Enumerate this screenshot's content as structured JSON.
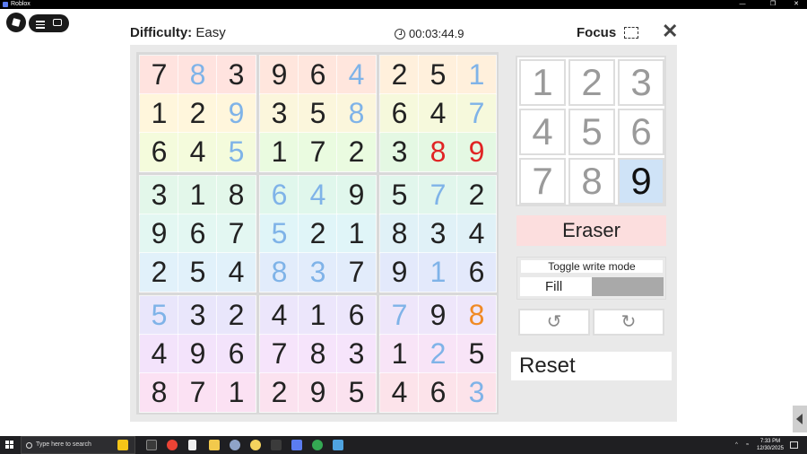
{
  "window": {
    "title": "Roblox",
    "controls": [
      "—",
      "❐",
      "✕"
    ]
  },
  "header": {
    "difficulty_label": "Difficulty:",
    "difficulty_value": "Easy",
    "timer": "00:03:44.9",
    "focus_label": "Focus",
    "close_symbol": "✕"
  },
  "board": {
    "boxes": [
      {
        "color": "#fff1d9",
        "rows": [
          [
            "7",
            "8",
            "3"
          ],
          [
            "1",
            "2",
            "9"
          ],
          [
            "6",
            "4",
            "5"
          ]
        ],
        "kinds": [
          [
            "g",
            "u",
            "g"
          ],
          [
            "g",
            "g",
            "u"
          ],
          [
            "g",
            "g",
            "u"
          ]
        ],
        "tints": [
          "#ffe3df",
          "#fff6dc",
          "#f4fbdc"
        ]
      },
      {
        "color": "#fff1d9",
        "rows": [
          [
            "9",
            "6",
            "4"
          ],
          [
            "3",
            "5",
            "8"
          ],
          [
            "1",
            "7",
            "2"
          ]
        ],
        "kinds": [
          [
            "g",
            "g",
            "u"
          ],
          [
            "g",
            "g",
            "u"
          ],
          [
            "g",
            "g",
            "g"
          ]
        ],
        "tints": [
          "#ffe6dd",
          "#fbf6dc",
          "#eafbe0"
        ]
      },
      {
        "color": "#fff1d9",
        "rows": [
          [
            "2",
            "5",
            "1"
          ],
          [
            "6",
            "4",
            "7"
          ],
          [
            "3",
            "8",
            "9"
          ]
        ],
        "kinds": [
          [
            "g",
            "g",
            "u"
          ],
          [
            "g",
            "g",
            "u"
          ],
          [
            "g",
            "e",
            "e"
          ]
        ],
        "tints": [
          "#fff0dc",
          "#f6f9dc",
          "#e4f8e3"
        ]
      },
      {
        "color": "#e5f6ee",
        "rows": [
          [
            "3",
            "1",
            "8"
          ],
          [
            "9",
            "6",
            "7"
          ],
          [
            "2",
            "5",
            "4"
          ]
        ],
        "kinds": [
          [
            "g",
            "g",
            "g"
          ],
          [
            "g",
            "g",
            "g"
          ],
          [
            "g",
            "g",
            "g"
          ]
        ],
        "tints": [
          "#e3f7ea",
          "#e3f7f2",
          "#e1f1fa"
        ]
      },
      {
        "color": "#e5f6ee",
        "rows": [
          [
            "6",
            "4",
            "9"
          ],
          [
            "5",
            "2",
            "1"
          ],
          [
            "8",
            "3",
            "7"
          ]
        ],
        "kinds": [
          [
            "u",
            "u",
            "g"
          ],
          [
            "u",
            "g",
            "g"
          ],
          [
            "u",
            "u",
            "g"
          ]
        ],
        "tints": [
          "#e0f7ec",
          "#e0f5f8",
          "#e2ecfb"
        ]
      },
      {
        "color": "#e5f6ee",
        "rows": [
          [
            "5",
            "7",
            "2"
          ],
          [
            "8",
            "3",
            "4"
          ],
          [
            "9",
            "1",
            "6"
          ]
        ],
        "kinds": [
          [
            "g",
            "u",
            "g"
          ],
          [
            "g",
            "g",
            "g"
          ],
          [
            "g",
            "u",
            "g"
          ]
        ],
        "tints": [
          "#e1f6ec",
          "#e0f1f7",
          "#e3e9fb"
        ]
      },
      {
        "color": "#f1e6fb",
        "rows": [
          [
            "5",
            "3",
            "2"
          ],
          [
            "4",
            "9",
            "6"
          ],
          [
            "8",
            "7",
            "1"
          ]
        ],
        "kinds": [
          [
            "u",
            "g",
            "g"
          ],
          [
            "g",
            "g",
            "g"
          ],
          [
            "g",
            "g",
            "g"
          ]
        ],
        "tints": [
          "#e9e6fb",
          "#f3e3fb",
          "#fbe1f3"
        ]
      },
      {
        "color": "#f1e6fb",
        "rows": [
          [
            "4",
            "1",
            "6"
          ],
          [
            "7",
            "8",
            "3"
          ],
          [
            "2",
            "9",
            "5"
          ]
        ],
        "kinds": [
          [
            "g",
            "g",
            "g"
          ],
          [
            "g",
            "g",
            "g"
          ],
          [
            "g",
            "g",
            "g"
          ]
        ],
        "tints": [
          "#ece6fb",
          "#f6e4fb",
          "#fbe2ef"
        ]
      },
      {
        "color": "#f1e6fb",
        "rows": [
          [
            "7",
            "9",
            "8"
          ],
          [
            "1",
            "2",
            "5"
          ],
          [
            "4",
            "6",
            "3"
          ]
        ],
        "kinds": [
          [
            "u",
            "g",
            "h"
          ],
          [
            "g",
            "u",
            "g"
          ],
          [
            "g",
            "g",
            "u"
          ]
        ],
        "tints": [
          "#eee6fa",
          "#f8e4f7",
          "#fce3ea"
        ]
      }
    ]
  },
  "numpad": {
    "keys": [
      "1",
      "2",
      "3",
      "4",
      "5",
      "6",
      "7",
      "8",
      "9"
    ],
    "selected": "9"
  },
  "controls": {
    "eraser_label": "Eraser",
    "toggle_label": "Toggle write mode",
    "toggle_value": "Fill",
    "undo_symbol": "↺",
    "redo_symbol": "↻",
    "reset_label": "Reset"
  },
  "taskbar": {
    "search_placeholder": "Type here to search",
    "time": "7:33 PM",
    "date": "12/30/2025"
  }
}
